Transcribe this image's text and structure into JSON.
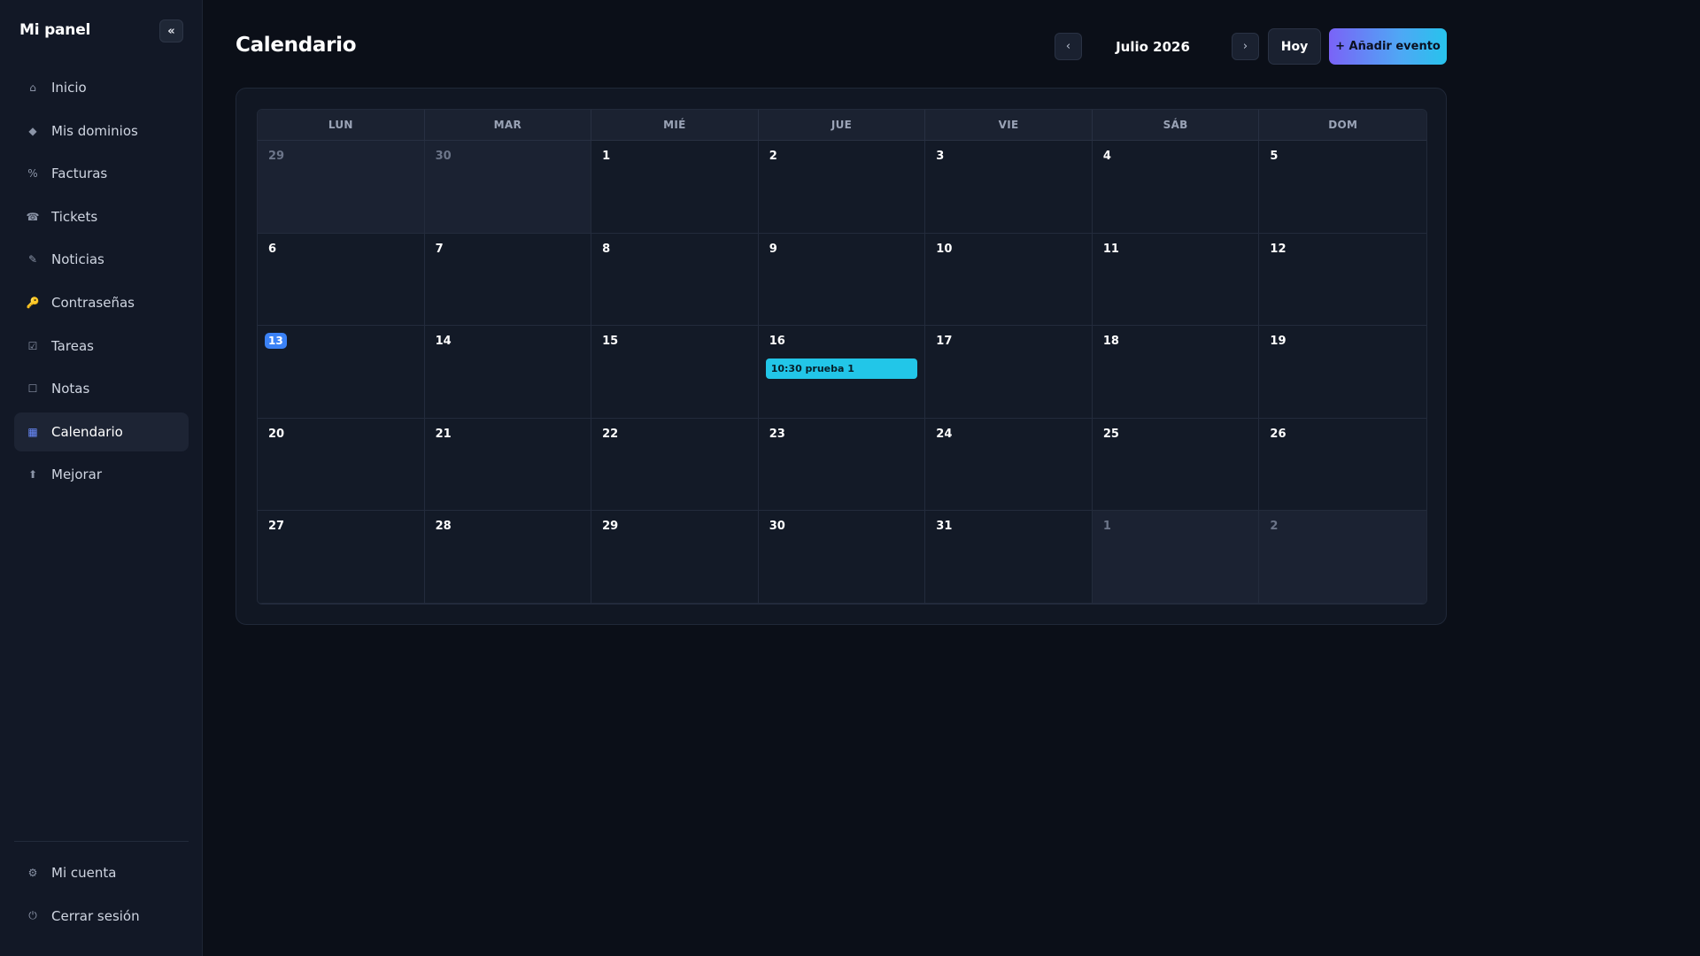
{
  "sidebar": {
    "brand": "Mi panel",
    "collapse_label": "«",
    "items": [
      {
        "label": "Inicio",
        "icon": "⌂",
        "name": "home"
      },
      {
        "label": "Mis dominios",
        "icon": "◆",
        "name": "domains"
      },
      {
        "label": "Facturas",
        "icon": "%",
        "name": "invoices"
      },
      {
        "label": "Tickets",
        "icon": "☎",
        "name": "tickets"
      },
      {
        "label": "Noticias",
        "icon": "✎",
        "name": "news"
      },
      {
        "label": "Contraseñas",
        "icon": "🔑",
        "name": "passwords"
      },
      {
        "label": "Tareas",
        "icon": "☑",
        "name": "tasks"
      },
      {
        "label": "Notas",
        "icon": "☐",
        "name": "notes"
      },
      {
        "label": "Calendario",
        "icon": "▦",
        "name": "calendar"
      },
      {
        "label": "Mejorar",
        "icon": "⬆",
        "name": "upgrade"
      }
    ],
    "bottom_items": [
      {
        "label": "Mi cuenta",
        "icon": "⚙",
        "name": "account"
      },
      {
        "label": "Cerrar sesión",
        "icon": "⏻",
        "name": "logout"
      }
    ],
    "active": "Calendario"
  },
  "header": {
    "title": "Calendario",
    "month_label": "Julio 2026",
    "prev_label": "‹",
    "next_label": "›",
    "today_label": "Hoy",
    "add_label": "+ Añadir evento"
  },
  "calendar": {
    "weekdays": [
      "LUN",
      "MAR",
      "MIÉ",
      "JUE",
      "VIE",
      "SÁB",
      "DOM"
    ],
    "weeks": [
      [
        {
          "n": "29",
          "outside": true
        },
        {
          "n": "30",
          "outside": true
        },
        {
          "n": "1"
        },
        {
          "n": "2"
        },
        {
          "n": "3"
        },
        {
          "n": "4"
        },
        {
          "n": "5"
        }
      ],
      [
        {
          "n": "6"
        },
        {
          "n": "7"
        },
        {
          "n": "8"
        },
        {
          "n": "9"
        },
        {
          "n": "10"
        },
        {
          "n": "11"
        },
        {
          "n": "12"
        }
      ],
      [
        {
          "n": "13",
          "today": true
        },
        {
          "n": "14"
        },
        {
          "n": "15"
        },
        {
          "n": "16",
          "events": [
            "10:30 prueba 1"
          ]
        },
        {
          "n": "17"
        },
        {
          "n": "18"
        },
        {
          "n": "19"
        }
      ],
      [
        {
          "n": "20"
        },
        {
          "n": "21"
        },
        {
          "n": "22"
        },
        {
          "n": "23"
        },
        {
          "n": "24"
        },
        {
          "n": "25"
        },
        {
          "n": "26"
        }
      ],
      [
        {
          "n": "27"
        },
        {
          "n": "28"
        },
        {
          "n": "29"
        },
        {
          "n": "30"
        },
        {
          "n": "31"
        },
        {
          "n": "1",
          "outside": true
        },
        {
          "n": "2",
          "outside": true
        }
      ]
    ]
  },
  "colors": {
    "accent": "#3b82f6",
    "event": "#22c6e8",
    "background": "#0b0f18",
    "sidebar": "#121826"
  }
}
